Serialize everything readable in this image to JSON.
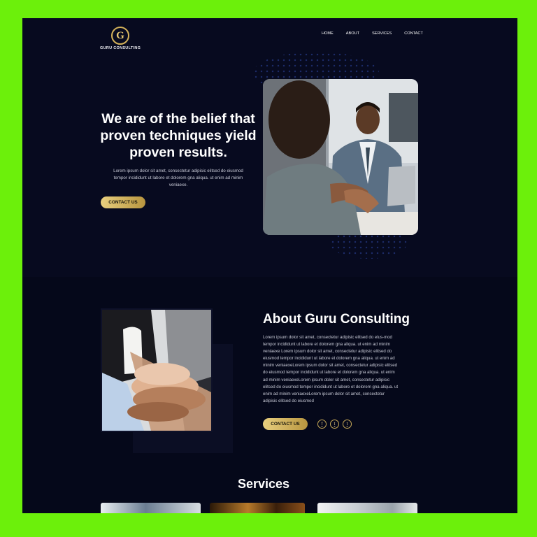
{
  "brand": {
    "name": "GURU CONSULTING",
    "mark": "G",
    "accent": "#d4b25a",
    "background": "#070a1f",
    "frame": "#6cf00b"
  },
  "nav": {
    "items": [
      "HOME",
      "ABOUT",
      "SERVICES",
      "CONTACT"
    ]
  },
  "hero": {
    "title": "We are of the belief that proven techniques yield proven results.",
    "body": "Lorem ipsum dolor sit amet, consectetur adipisic elitsed do eiusmod tempor incididunt ut labore et dolorem gna aliqua. ut enim ad minim veniaexe.",
    "cta": "CONTACT US",
    "image": "business-meeting-photo"
  },
  "about": {
    "title": "About Guru Consulting",
    "body": "Lorem ipsum dolor sit amet, consectetur adipisic elitsed do elus-mod tempor incididunt ut labore et dolorem gna aliqua. ut enim ad minim veniaexe Lorem ipsum dolor sit amet, consectetur adipisic elitsed do eiusmod tempor incididunt ut labore et dolorem gna aliqua. ut enim ad minim veniaexeLorem ipsum dolor sit amet, consectetur adipisic elitsed do eiusmod tempor incididunt ut labore et dolorem gna aliqua. ut enim ad minim veniaexeLorem ipsum dolor sit amet, consectetur adipisic elitsed do eiusmod tempor incididunt ut labore et dolorem gna aliqua. ut enim ad minim veniaexeLorem ipsum dolor sit amet, consectetur adipisic elitsed do eiusmod",
    "cta": "CONTACT US",
    "image": "team-hands-photo",
    "social": [
      {
        "icon": "facebook-icon",
        "glyph": "f"
      },
      {
        "icon": "twitter-icon",
        "glyph": "t"
      },
      {
        "icon": "tumblr-icon",
        "glyph": "t"
      }
    ]
  },
  "services": {
    "title": "Services",
    "cards": [
      "service-photo-1",
      "service-photo-2",
      "service-photo-3"
    ]
  }
}
